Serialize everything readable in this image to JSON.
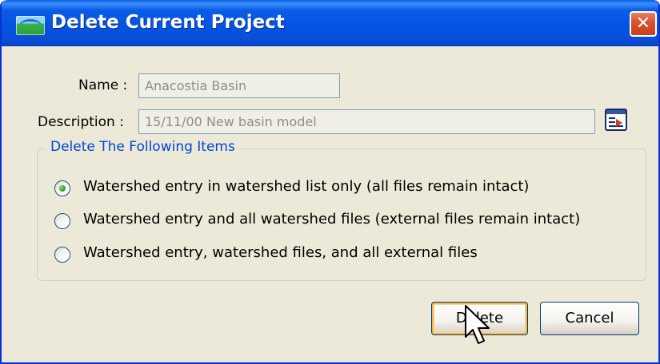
{
  "window": {
    "title": "Delete Current Project",
    "close_glyph": "✕"
  },
  "form": {
    "name_label": "Name :",
    "name_value": "Anacostia Basin",
    "description_label": "Description :",
    "description_value": "15/11/00 New basin model"
  },
  "group": {
    "legend": "Delete The Following Items",
    "options": [
      {
        "label": "Watershed entry in watershed list only (all files remain intact)",
        "selected": true
      },
      {
        "label": "Watershed entry and all watershed files (external files remain intact)",
        "selected": false
      },
      {
        "label": "Watershed entry, watershed files, and all external files",
        "selected": false
      }
    ]
  },
  "buttons": {
    "delete_label": "Delete",
    "cancel_label": "Cancel"
  },
  "icons": {
    "app": "watershed-app-icon",
    "close": "close-icon",
    "description_editor": "edit-description-icon",
    "cursor": "mouse-pointer-icon"
  },
  "colors": {
    "title_bar": "#0a5ce8",
    "close_button": "#d9532f",
    "group_legend": "#0046d5",
    "radio_selected": "#21a121",
    "default_button_highlight": "#f8b34a"
  }
}
